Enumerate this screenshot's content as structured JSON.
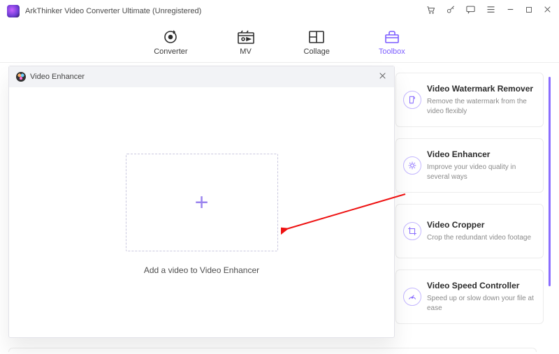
{
  "app": {
    "title": "ArkThinker Video Converter Ultimate (Unregistered)"
  },
  "tabs": {
    "converter": "Converter",
    "mv": "MV",
    "collage": "Collage",
    "toolbox": "Toolbox"
  },
  "modal": {
    "title": "Video Enhancer",
    "drop_label": "Add a video to Video Enhancer"
  },
  "tools": [
    {
      "title": "Video Watermark Remover",
      "desc": "Remove the watermark from the video flexibly"
    },
    {
      "title": "Video Enhancer",
      "desc": "Improve your video quality in several ways"
    },
    {
      "title": "Video Cropper",
      "desc": "Crop the redundant video footage"
    },
    {
      "title": "Video Speed Controller",
      "desc": "Speed up or slow down your file at ease"
    }
  ]
}
